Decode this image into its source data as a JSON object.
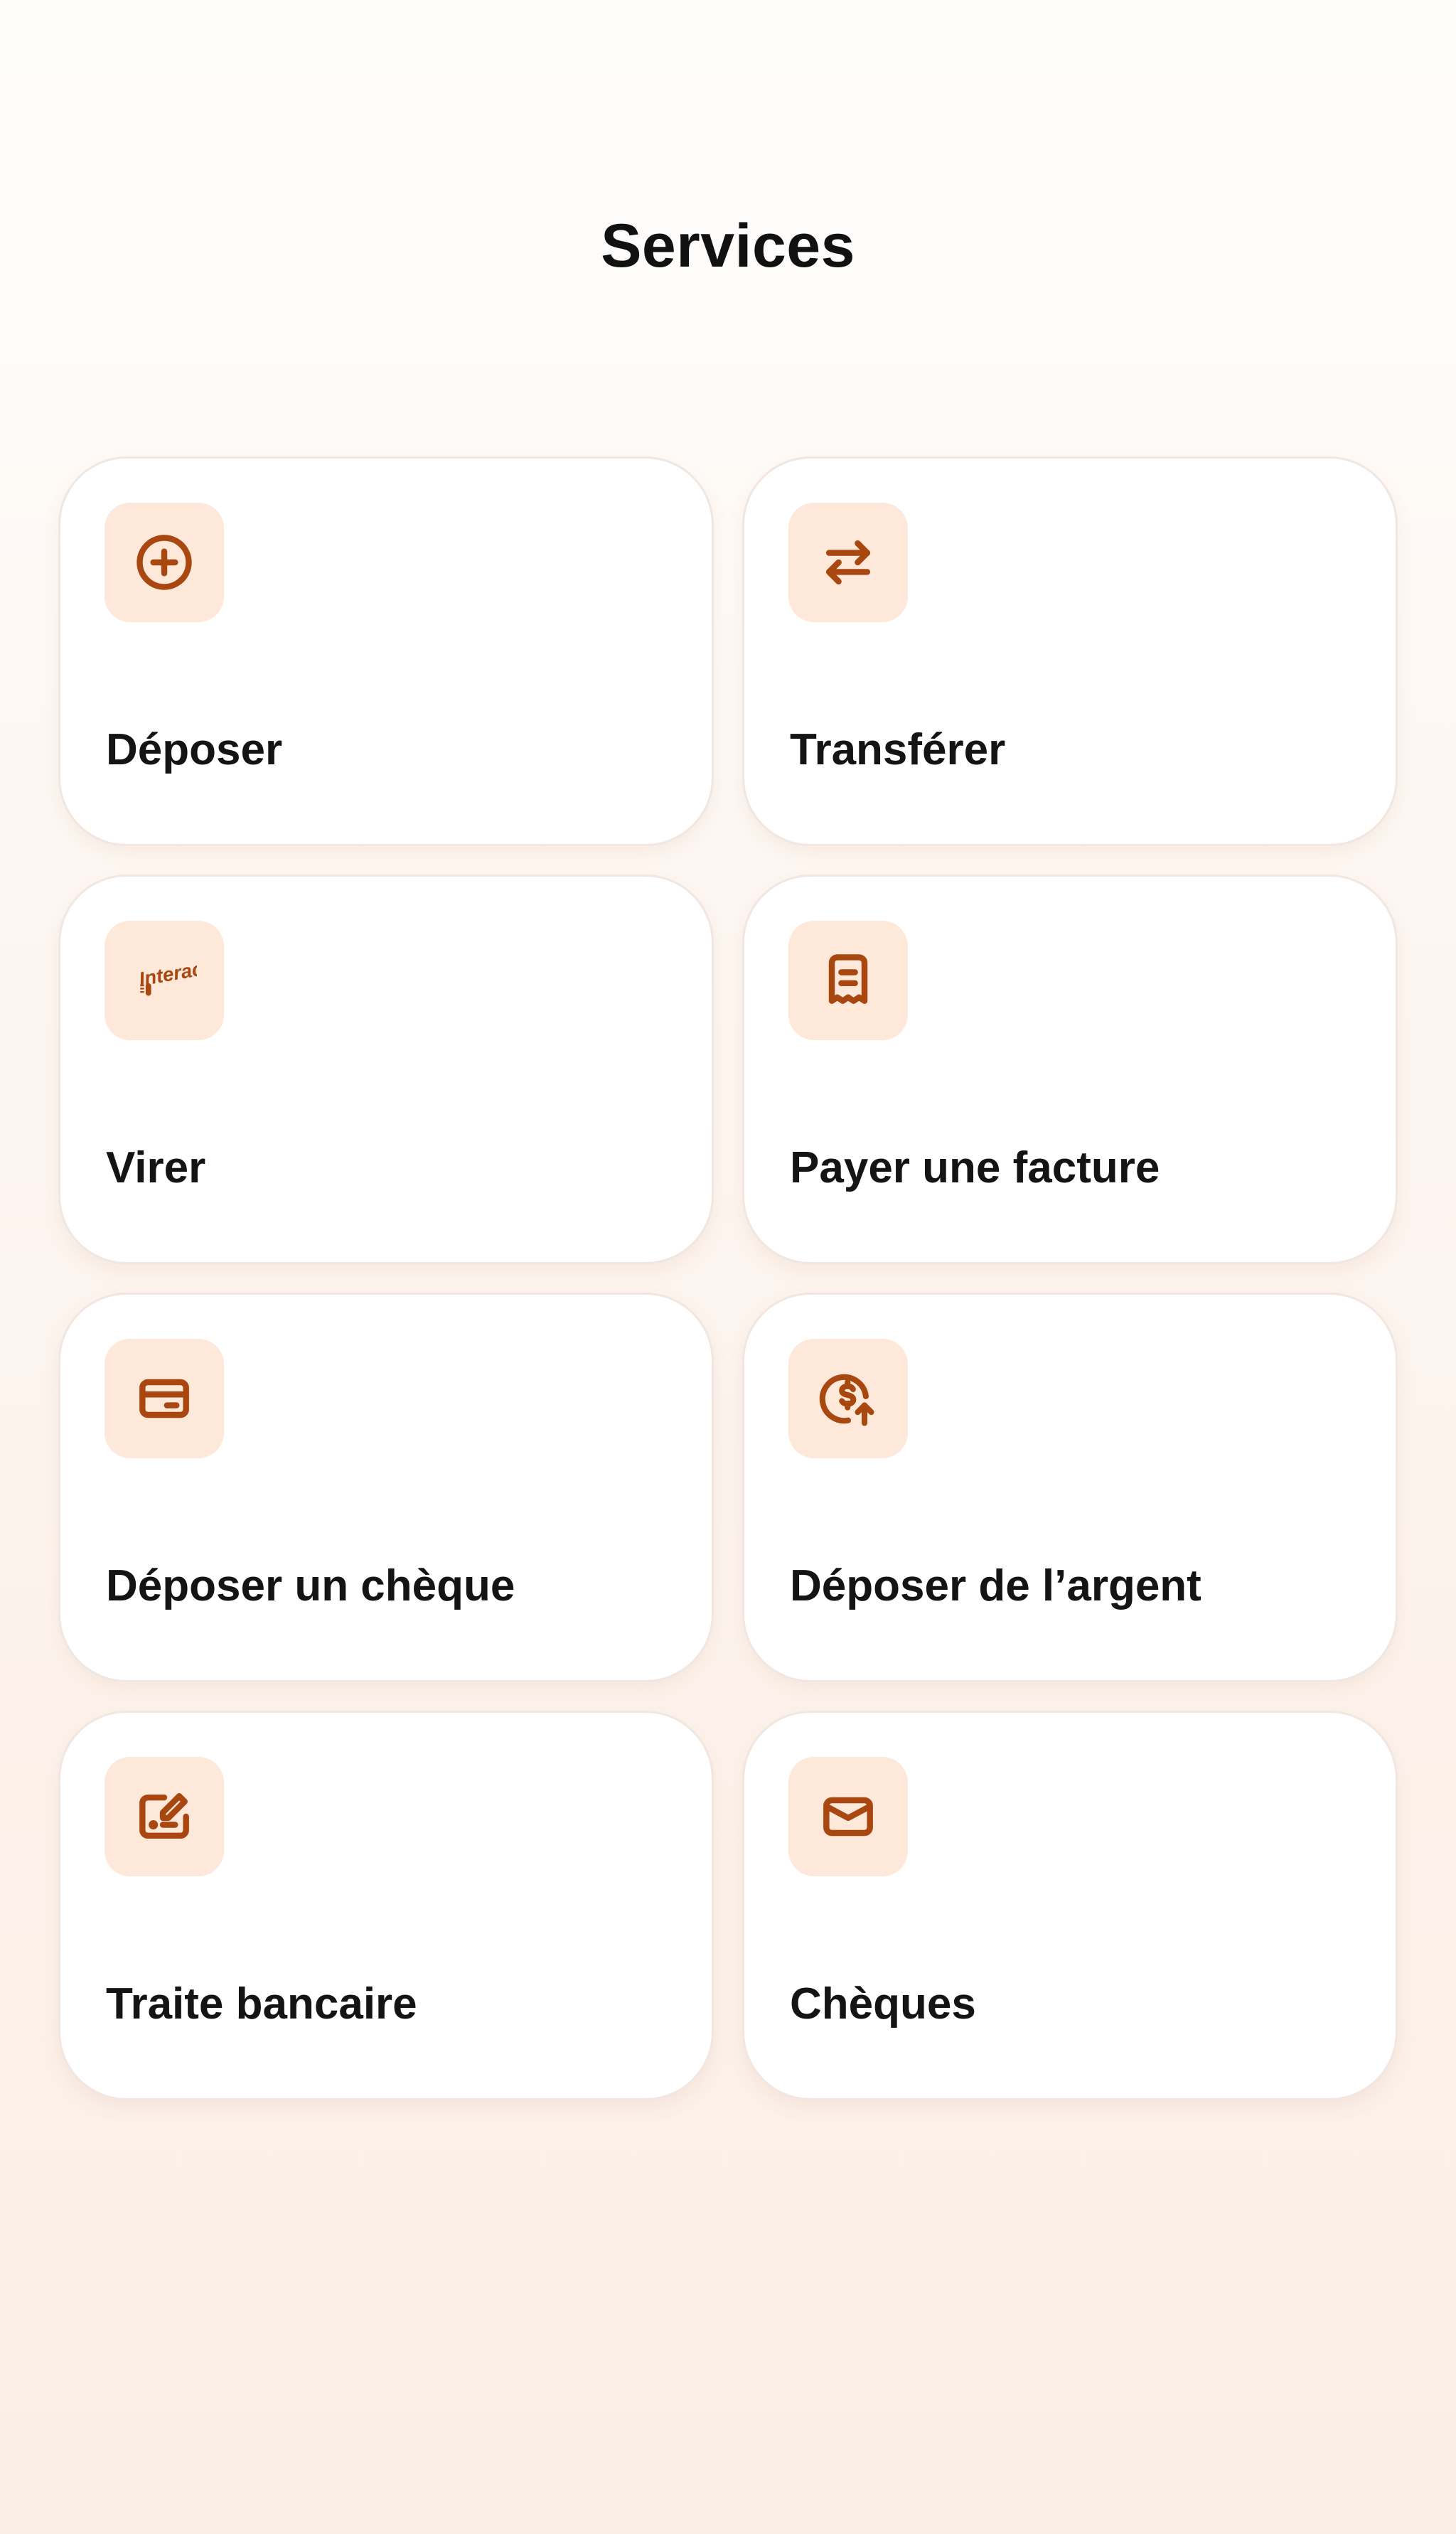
{
  "page": {
    "title": "Services"
  },
  "theme": {
    "accent": "#a8470f",
    "icon_background": "#fde8da",
    "card_background": "#ffffff",
    "card_border": "#f1e7e0"
  },
  "services": [
    {
      "label": "Déposer",
      "icon": "plus-circle-icon"
    },
    {
      "label": "Transférer",
      "icon": "transfer-arrows-icon"
    },
    {
      "label": "Virer",
      "icon": "interac-icon",
      "icon_text": "Interac"
    },
    {
      "label": "Payer une facture",
      "icon": "receipt-icon"
    },
    {
      "label": "Déposer un chèque",
      "icon": "cheque-icon"
    },
    {
      "label": "Déposer de l’argent",
      "icon": "dollar-upload-icon"
    },
    {
      "label": "Traite bancaire",
      "icon": "bank-draft-icon"
    },
    {
      "label": "Chèques",
      "icon": "envelope-icon"
    }
  ]
}
